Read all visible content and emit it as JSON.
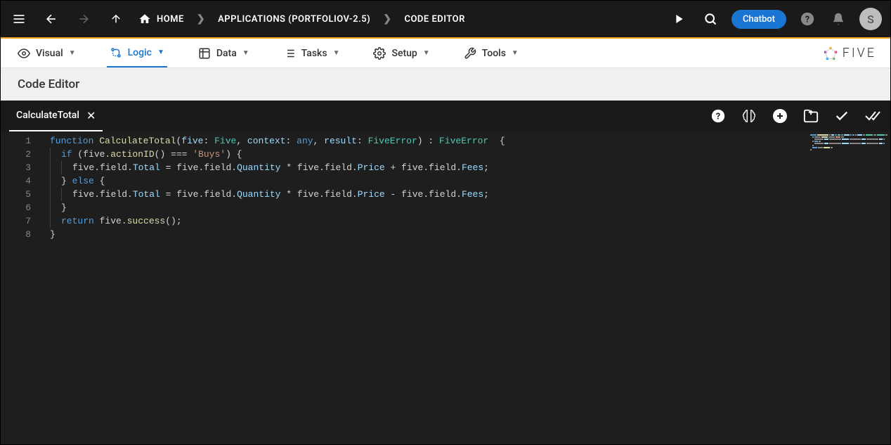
{
  "topbar": {
    "breadcrumb": {
      "home": "HOME",
      "applications": "APPLICATIONS (PORTFOLIOV-2.5)",
      "editor": "CODE EDITOR"
    },
    "chatbot": "Chatbot",
    "avatar_letter": "S"
  },
  "menubar": {
    "visual": "Visual",
    "logic": "Logic",
    "data": "Data",
    "tasks": "Tasks",
    "setup": "Setup",
    "tools": "Tools",
    "logo": "FIVE"
  },
  "titlebar": {
    "title": "Code Editor"
  },
  "editor": {
    "tab_name": "CalculateTotal",
    "code": {
      "lines": [
        {
          "n": "1",
          "tokens": [
            {
              "t": "function",
              "c": "kw"
            },
            {
              "t": " ",
              "c": ""
            },
            {
              "t": "CalculateTotal",
              "c": "fn"
            },
            {
              "t": "(",
              "c": "punct"
            },
            {
              "t": "five",
              "c": "prop"
            },
            {
              "t": ": ",
              "c": "punct"
            },
            {
              "t": "Five",
              "c": "type"
            },
            {
              "t": ", ",
              "c": "punct"
            },
            {
              "t": "context",
              "c": "prop"
            },
            {
              "t": ": ",
              "c": "punct"
            },
            {
              "t": "any",
              "c": "kw"
            },
            {
              "t": ", ",
              "c": "punct"
            },
            {
              "t": "result",
              "c": "prop"
            },
            {
              "t": ": ",
              "c": "punct"
            },
            {
              "t": "FiveError",
              "c": "type"
            },
            {
              "t": ") : ",
              "c": "punct"
            },
            {
              "t": "FiveError",
              "c": "type"
            },
            {
              "t": "  {",
              "c": "punct"
            }
          ]
        },
        {
          "n": "2",
          "indent": 1,
          "tokens": [
            {
              "t": "if",
              "c": "kw"
            },
            {
              "t": " (five.",
              "c": "punct"
            },
            {
              "t": "actionID",
              "c": "fn"
            },
            {
              "t": "() === ",
              "c": "punct"
            },
            {
              "t": "'Buys'",
              "c": "str"
            },
            {
              "t": ") {",
              "c": "punct"
            }
          ]
        },
        {
          "n": "3",
          "indent": 2,
          "tokens": [
            {
              "t": "five.field.",
              "c": "punct"
            },
            {
              "t": "Total",
              "c": "prop"
            },
            {
              "t": " = five.field.",
              "c": "punct"
            },
            {
              "t": "Quantity",
              "c": "prop"
            },
            {
              "t": " * five.field.",
              "c": "punct"
            },
            {
              "t": "Price",
              "c": "prop"
            },
            {
              "t": " + five.field.",
              "c": "punct"
            },
            {
              "t": "Fees",
              "c": "prop"
            },
            {
              "t": ";",
              "c": "punct"
            }
          ]
        },
        {
          "n": "4",
          "indent": 1,
          "tokens": [
            {
              "t": "} ",
              "c": "punct"
            },
            {
              "t": "else",
              "c": "kw"
            },
            {
              "t": " {",
              "c": "punct"
            }
          ]
        },
        {
          "n": "5",
          "indent": 2,
          "tokens": [
            {
              "t": "five.field.",
              "c": "punct"
            },
            {
              "t": "Total",
              "c": "prop"
            },
            {
              "t": " = five.field.",
              "c": "punct"
            },
            {
              "t": "Quantity",
              "c": "prop"
            },
            {
              "t": " * five.field.",
              "c": "punct"
            },
            {
              "t": "Price",
              "c": "prop"
            },
            {
              "t": " - five.field.",
              "c": "punct"
            },
            {
              "t": "Fees",
              "c": "prop"
            },
            {
              "t": ";",
              "c": "punct"
            }
          ]
        },
        {
          "n": "6",
          "indent": 1,
          "tokens": [
            {
              "t": "}",
              "c": "punct"
            }
          ]
        },
        {
          "n": "7",
          "indent": 1,
          "tokens": [
            {
              "t": "return",
              "c": "kw"
            },
            {
              "t": " five.",
              "c": "punct"
            },
            {
              "t": "success",
              "c": "fn"
            },
            {
              "t": "();",
              "c": "punct"
            }
          ]
        },
        {
          "n": "8",
          "tokens": [
            {
              "t": "}",
              "c": "punct"
            }
          ]
        }
      ]
    }
  }
}
